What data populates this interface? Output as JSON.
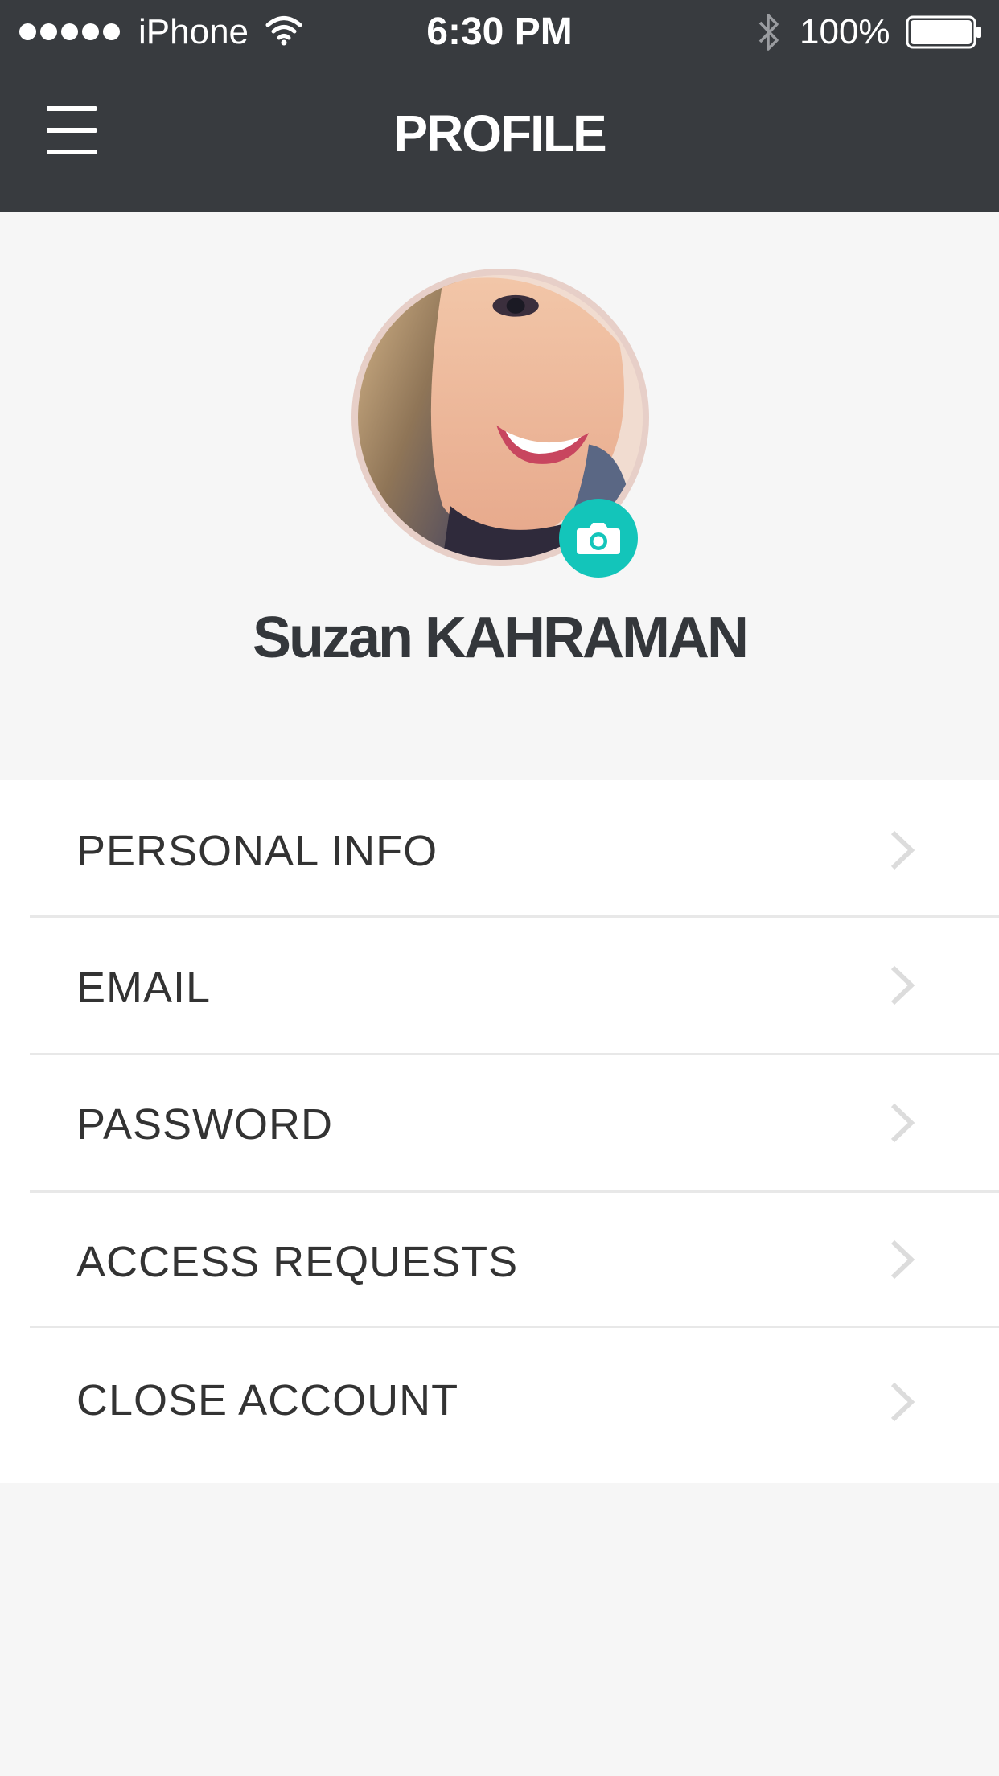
{
  "status_bar": {
    "carrier": "iPhone",
    "time": "6:30 PM",
    "battery": "100%",
    "signal_icon": "signal-dots-icon",
    "wifi_icon": "wifi-icon",
    "bluetooth_icon": "bluetooth-icon",
    "battery_icon": "battery-icon"
  },
  "header": {
    "title": "PROFILE",
    "menu_icon": "hamburger-menu-icon",
    "background": "#383b3f"
  },
  "profile": {
    "name": "Suzan KAHRAMAN",
    "avatar": "profile-photo",
    "camera_icon": "camera-icon",
    "accent": "#13c5ba"
  },
  "menu": {
    "items": [
      {
        "label": "PERSONAL INFO"
      },
      {
        "label": "EMAIL"
      },
      {
        "label": "PASSWORD"
      },
      {
        "label": "ACCESS REQUESTS"
      },
      {
        "label": "CLOSE ACCOUNT"
      }
    ],
    "chevron_icon": "chevron-right-icon"
  }
}
